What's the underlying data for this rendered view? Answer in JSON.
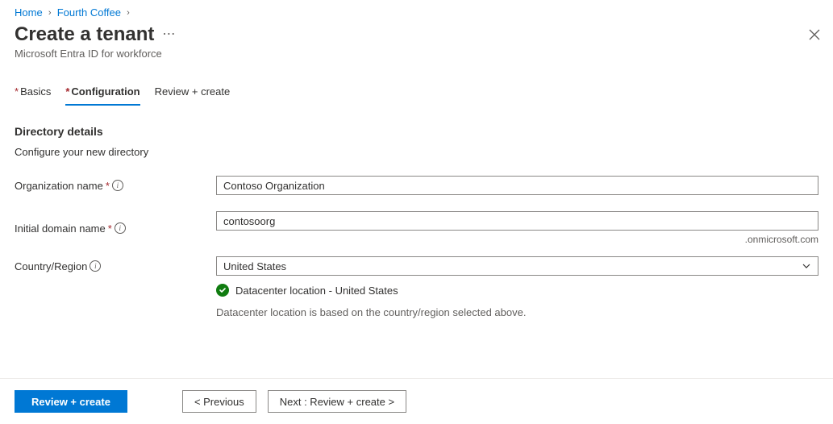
{
  "breadcrumb": {
    "home": "Home",
    "item1": "Fourth Coffee"
  },
  "header": {
    "title": "Create a tenant",
    "subtitle": "Microsoft Entra ID for workforce"
  },
  "tabs": {
    "basics": "Basics",
    "configuration": "Configuration",
    "review": "Review + create"
  },
  "section": {
    "title": "Directory details",
    "desc": "Configure your new directory"
  },
  "fields": {
    "org_label": "Organization name",
    "org_value": "Contoso Organization",
    "domain_label": "Initial domain name",
    "domain_value": "contosoorg",
    "domain_suffix": ".onmicrosoft.com",
    "region_label": "Country/Region",
    "region_value": "United States"
  },
  "datacenter": {
    "location": "Datacenter location - United States",
    "note": "Datacenter location is based on the country/region selected above."
  },
  "footer": {
    "review": "Review + create",
    "previous": "< Previous",
    "next": "Next : Review + create >"
  }
}
